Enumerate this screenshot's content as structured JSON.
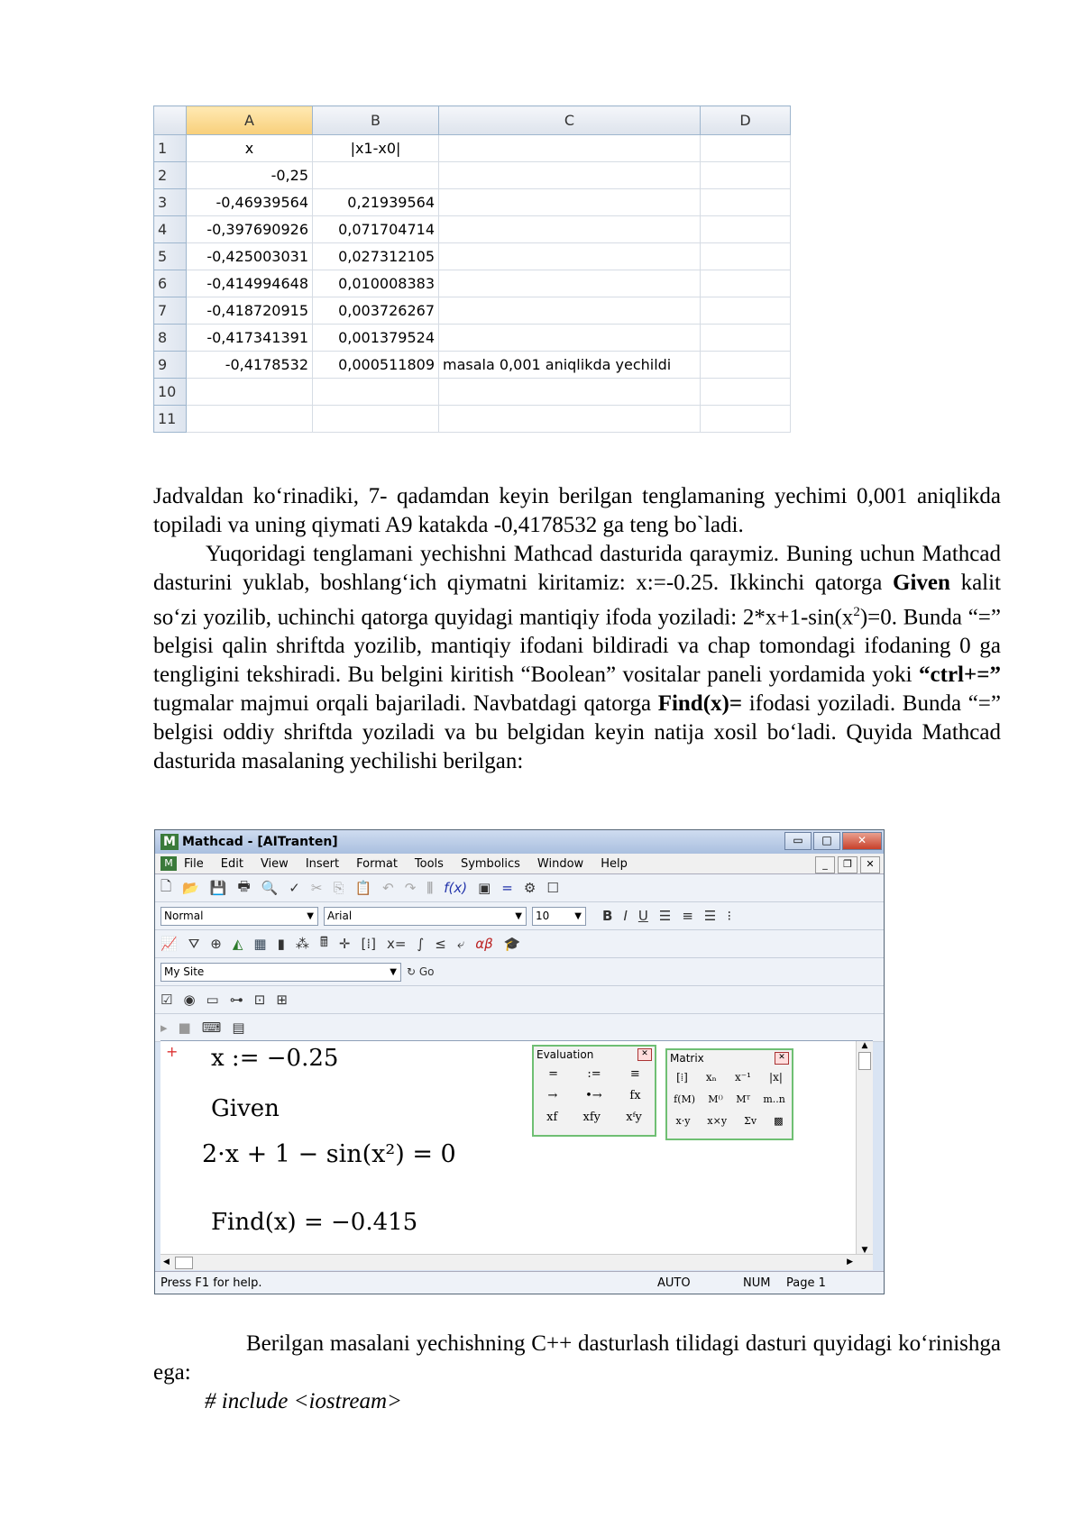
{
  "excel": {
    "columns": [
      "A",
      "B",
      "C",
      "D"
    ],
    "rows": [
      {
        "n": "1",
        "a": "x",
        "b": "|x1-x0|",
        "c": ""
      },
      {
        "n": "2",
        "a": "-0,25",
        "b": "",
        "c": ""
      },
      {
        "n": "3",
        "a": "-0,46939564",
        "b": "0,21939564",
        "c": ""
      },
      {
        "n": "4",
        "a": "-0,397690926",
        "b": "0,071704714",
        "c": ""
      },
      {
        "n": "5",
        "a": "-0,425003031",
        "b": "0,027312105",
        "c": ""
      },
      {
        "n": "6",
        "a": "-0,414994648",
        "b": "0,010008383",
        "c": ""
      },
      {
        "n": "7",
        "a": "-0,418720915",
        "b": "0,003726267",
        "c": ""
      },
      {
        "n": "8",
        "a": "-0,417341391",
        "b": "0,001379524",
        "c": ""
      },
      {
        "n": "9",
        "a": "-0,4178532",
        "b": "0,000511809",
        "c": "masala 0,001 aniqlikda yechildi"
      },
      {
        "n": "10",
        "a": "",
        "b": "",
        "c": ""
      },
      {
        "n": "11",
        "a": "",
        "b": "",
        "c": ""
      }
    ]
  },
  "text": {
    "p1": "Jadvaldan ko‘rinadiki, 7- qadamdan keyin berilgan tenglamaning yechimi 0,001 aniqlikda topiladi va uning qiymati A9 katakda -0,4178532 ga teng bo`ladi.",
    "p2a": "Yuqoridagi tenglamani yechishni Mathcad dasturida qaraymiz. Buning uchun Mathcad dasturini yuklab, boshlang‘ich qiymatni kiritamiz: x:=-0.25.   Ikkinchi qatorga ",
    "p2b": "Given",
    "p2c": " kalit so‘zi yozilib, uchinchi qatorga quyidagi mantiqiy ifoda yoziladi:     2*x+1-sin(x",
    "p2sup": "2",
    "p2d": ")=0. Bunda  “=”  belgisi qalin shriftda yozilib, mantiqiy ifodani bildiradi va chap tomondagi ifodaning 0 ga tengligini tekshiradi. Bu belgini kiritish “Boolean”   vositalar paneli yordamida yoki  ",
    "p2e": "“ctrl+=”",
    "p2f": "  tugmalar majmui orqali bajariladi. Navbatdagi qatorga ",
    "p2g": "Find(x)=",
    "p2h": " ifodasi yoziladi. Bunda      “=” belgisi oddiy shriftda yoziladi va bu belgidan keyin natija xosil bo‘ladi. Quyida Mathcad dasturida masalaning yechilishi  berilgan:",
    "p3": "Berilgan masalani yechishning C++ dasturlash tilidagi dasturi quyidagi ko‘rinishga ega:",
    "code": "# include <iostream>"
  },
  "mathcad": {
    "title": "Mathcad - [AITranten]",
    "menu": [
      "File",
      "Edit",
      "View",
      "Insert",
      "Format",
      "Tools",
      "Symbolics",
      "Window",
      "Help"
    ],
    "style_combo": "Normal",
    "font_combo": "Arial",
    "size_combo": "10",
    "site_combo": "My Site",
    "go_label": "Go",
    "line1": "x := −0.25",
    "line2": "Given",
    "line3": "2·x + 1 − sin(x²) = 0",
    "line4": "Find(x) = −0.415",
    "eval_title": "Evaluation",
    "matrix_title": "Matrix",
    "status_help": "Press F1 for help.",
    "status_auto": "AUTO",
    "status_num": "NUM",
    "status_page": "Page 1"
  }
}
